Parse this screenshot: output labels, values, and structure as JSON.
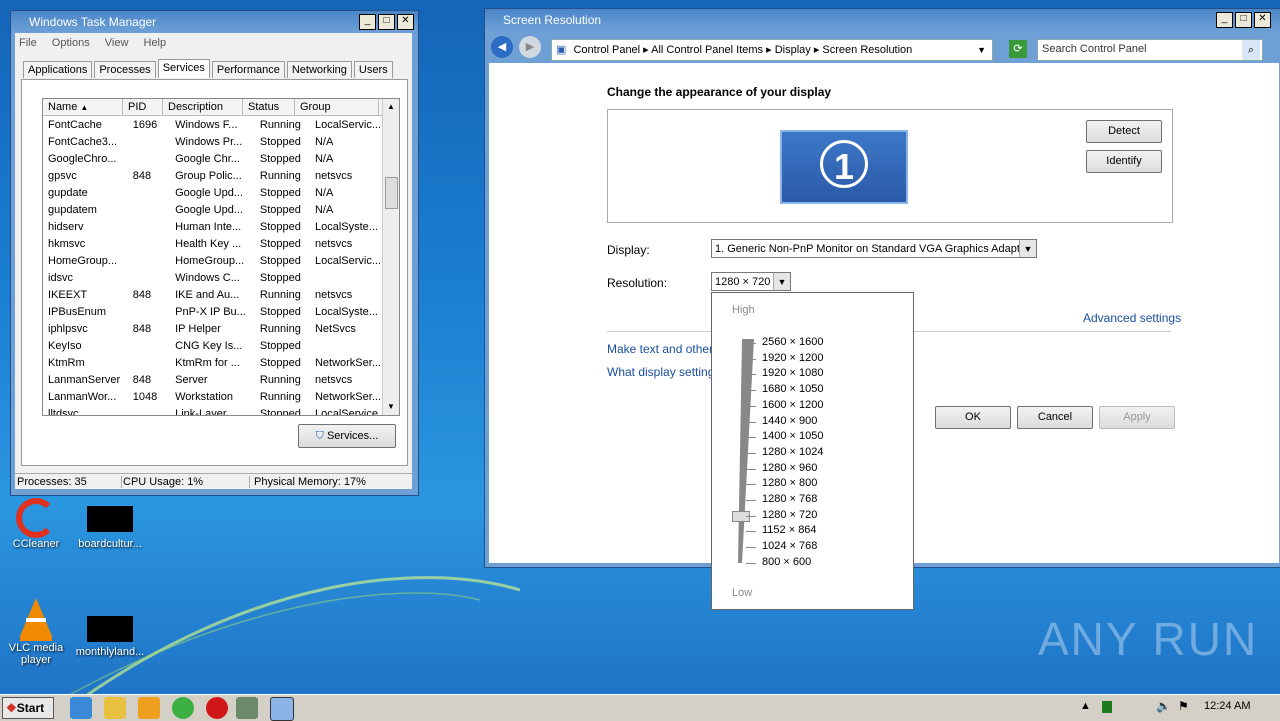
{
  "task_manager": {
    "title": "Windows Task Manager",
    "menu": [
      "File",
      "Options",
      "View",
      "Help"
    ],
    "tabs": [
      "Applications",
      "Processes",
      "Services",
      "Performance",
      "Networking",
      "Users"
    ],
    "columns": [
      "Name",
      "PID",
      "Description",
      "Status",
      "Group"
    ],
    "rows": [
      [
        "FontCache",
        "1696",
        "Windows F...",
        "Running",
        "LocalServic..."
      ],
      [
        "FontCache3...",
        "",
        "Windows Pr...",
        "Stopped",
        "N/A"
      ],
      [
        "GoogleChro...",
        "",
        "Google Chr...",
        "Stopped",
        "N/A"
      ],
      [
        "gpsvc",
        "848",
        "Group Polic...",
        "Running",
        "netsvcs"
      ],
      [
        "gupdate",
        "",
        "Google Upd...",
        "Stopped",
        "N/A"
      ],
      [
        "gupdatem",
        "",
        "Google Upd...",
        "Stopped",
        "N/A"
      ],
      [
        "hidserv",
        "",
        "Human Inte...",
        "Stopped",
        "LocalSyste..."
      ],
      [
        "hkmsvc",
        "",
        "Health Key ...",
        "Stopped",
        "netsvcs"
      ],
      [
        "HomeGroup...",
        "",
        "HomeGroup...",
        "Stopped",
        "LocalServic..."
      ],
      [
        "idsvc",
        "",
        "Windows C...",
        "Stopped",
        ""
      ],
      [
        "IKEEXT",
        "848",
        "IKE and Au...",
        "Running",
        "netsvcs"
      ],
      [
        "IPBusEnum",
        "",
        "PnP-X IP Bu...",
        "Stopped",
        "LocalSyste..."
      ],
      [
        "iphlpsvc",
        "848",
        "IP Helper",
        "Running",
        "NetSvcs"
      ],
      [
        "KeyIso",
        "",
        "CNG Key Is...",
        "Stopped",
        ""
      ],
      [
        "KtmRm",
        "",
        "KtmRm for ...",
        "Stopped",
        "NetworkSer..."
      ],
      [
        "LanmanServer",
        "848",
        "Server",
        "Running",
        "netsvcs"
      ],
      [
        "LanmanWor...",
        "1048",
        "Workstation",
        "Running",
        "NetworkSer..."
      ],
      [
        "lltdsvc",
        "",
        "Link-Layer ...",
        "Stopped",
        "LocalService"
      ]
    ],
    "services_button": "Services...",
    "status": {
      "processes": "Processes: 35",
      "cpu": "CPU Usage: 1%",
      "memory": "Physical Memory: 17%"
    }
  },
  "screen_resolution": {
    "title": "Screen Resolution",
    "breadcrumb": [
      "Control Panel",
      "All Control Panel Items",
      "Display",
      "Screen Resolution"
    ],
    "search_placeholder": "Search Control Panel",
    "heading": "Change the appearance of your display",
    "monitor_number": "1",
    "detect": "Detect",
    "identify": "Identify",
    "display_label": "Display:",
    "display_value": "1. Generic Non-PnP Monitor on Standard VGA Graphics Adapter",
    "resolution_label": "Resolution:",
    "resolution_value": "1280 × 720",
    "advanced": "Advanced settings",
    "link1": "Make text and other i",
    "link2": "What display settings",
    "ok": "OK",
    "cancel": "Cancel",
    "apply": "Apply",
    "slider_high": "High",
    "slider_low": "Low",
    "resolutions": [
      "2560 × 1600",
      "1920 × 1200",
      "1920 × 1080",
      "1680 × 1050",
      "1600 × 1200",
      "1440 × 900",
      "1400 × 1050",
      "1280 × 1024",
      "1280 × 960",
      "1280 × 800",
      "1280 × 768",
      "1280 × 720",
      "1152 × 864",
      "1024 × 768",
      "800 × 600"
    ],
    "selected_resolution": "1280 × 720"
  },
  "desktop": {
    "icons": [
      {
        "label": "CCleaner"
      },
      {
        "label": "boardcultur..."
      },
      {
        "label": "VLC media player"
      },
      {
        "label": "monthlyland..."
      }
    ],
    "watermark": "ANY RUN"
  },
  "taskbar": {
    "start": "Start",
    "clock": "12:24 AM"
  }
}
